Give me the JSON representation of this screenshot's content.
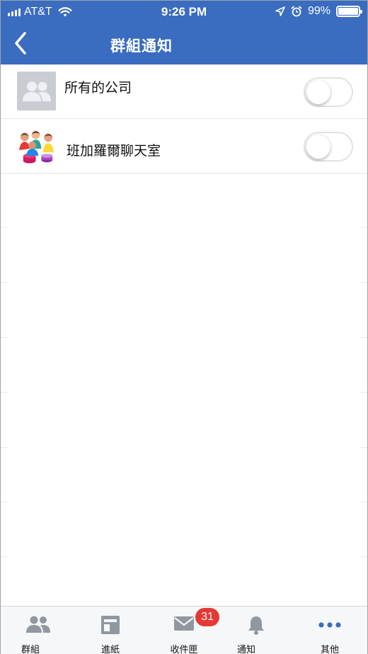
{
  "status_bar": {
    "carrier": "AT&T",
    "time": "9:26 PM",
    "battery_percent": "99%",
    "battery_level": 0.99
  },
  "header": {
    "title": "群組通知",
    "back_icon": "chevron-left-icon"
  },
  "groups": [
    {
      "name": "所有的公司",
      "avatar": "people-placeholder-icon",
      "enabled": false
    },
    {
      "name": "班加羅爾聊天室",
      "avatar": "group-photo-icon",
      "enabled": false
    }
  ],
  "tabbar": {
    "items": [
      {
        "label": "群組",
        "icon": "people-icon"
      },
      {
        "label": "進紙",
        "icon": "feed-icon"
      },
      {
        "label": "收件匣",
        "icon": "mail-icon",
        "badge": "31"
      },
      {
        "label": "通知",
        "icon": "bell-icon"
      },
      {
        "label": "其他",
        "icon": "more-icon"
      }
    ]
  },
  "colors": {
    "header_bg": "#3a6cbf",
    "badge_bg": "#e53935",
    "tab_icon": "#9097a0",
    "more_icon": "#3a6cbf"
  }
}
